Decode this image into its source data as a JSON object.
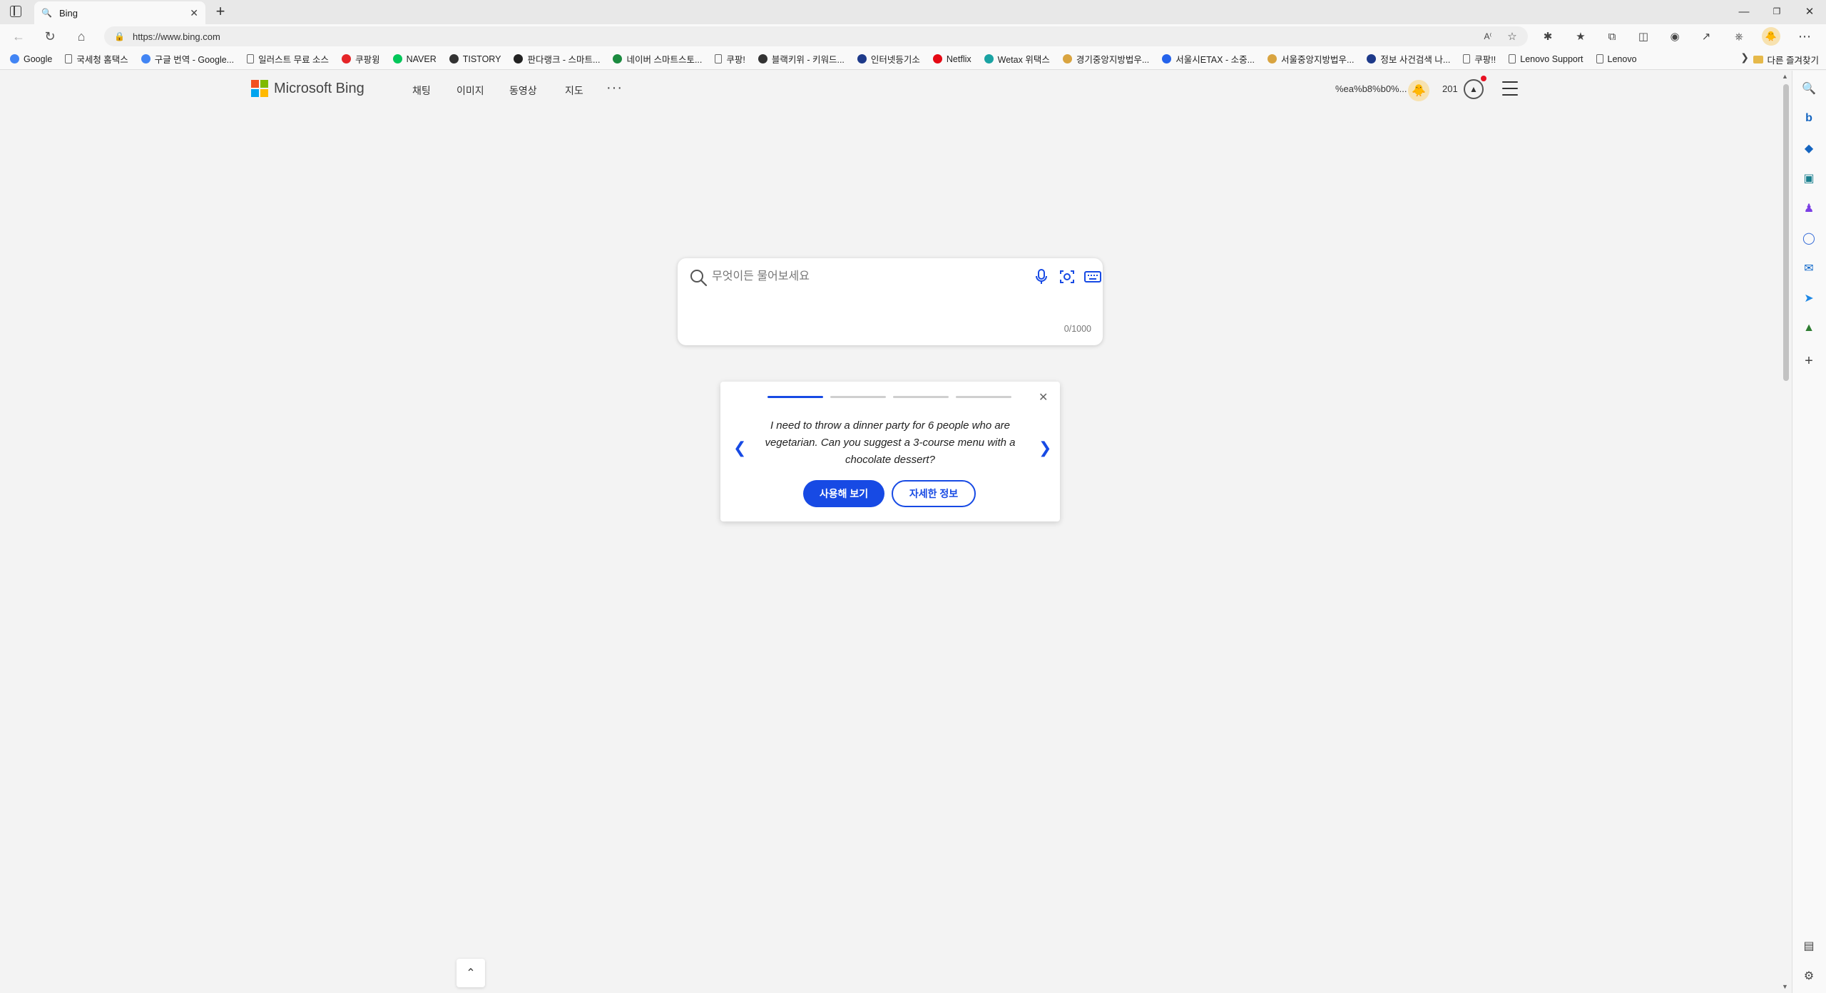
{
  "browser": {
    "tab_title": "Bing",
    "url": "https://www.bing.com",
    "bookmarks": [
      {
        "label": "Google",
        "icon": "google-icon",
        "color": "#4285f4"
      },
      {
        "label": "국세청 홈택스",
        "icon": "page-icon",
        "color": "#666666"
      },
      {
        "label": "구글 번역 - Google...",
        "icon": "google-icon",
        "color": "#4285f4"
      },
      {
        "label": "일러스트 무료 소스",
        "icon": "page-icon",
        "color": "#666666"
      },
      {
        "label": "쿠팡윙",
        "icon": "coupang-icon",
        "color": "#e52528"
      },
      {
        "label": "NAVER",
        "icon": "naver-icon",
        "color": "#03c75a"
      },
      {
        "label": "TISTORY",
        "icon": "tistory-icon",
        "color": "#333333"
      },
      {
        "label": "판다랭크 - 스마트...",
        "icon": "pandarank-icon",
        "color": "#222222"
      },
      {
        "label": "네이버 스마트스토...",
        "icon": "smartstore-icon",
        "color": "#1b8a3f"
      },
      {
        "label": "쿠팡!",
        "icon": "page-icon",
        "color": "#666666"
      },
      {
        "label": "블랙키위 - 키워드...",
        "icon": "blackkiwi-icon",
        "color": "#333333"
      },
      {
        "label": "인터넷등기소",
        "icon": "court-icon",
        "color": "#1e3a8a"
      },
      {
        "label": "Netflix",
        "icon": "netflix-icon",
        "color": "#e50914"
      },
      {
        "label": "Wetax 위택스",
        "icon": "wetax-icon",
        "color": "#1aa3a3"
      },
      {
        "label": "경기중앙지방법우...",
        "icon": "court-seal-icon",
        "color": "#d9a440"
      },
      {
        "label": "서울시ETAX - 소중...",
        "icon": "etax-icon",
        "color": "#2563eb"
      },
      {
        "label": "서울중앙지방법우...",
        "icon": "court-seal-icon",
        "color": "#d9a440"
      },
      {
        "label": "정보 사건검색 나...",
        "icon": "court-icon",
        "color": "#1e3a8a"
      },
      {
        "label": "쿠팡!!",
        "icon": "page-icon",
        "color": "#666666"
      },
      {
        "label": "Lenovo Support",
        "icon": "page-icon",
        "color": "#666666"
      },
      {
        "label": "Lenovo",
        "icon": "page-icon",
        "color": "#666666"
      }
    ],
    "other_favorites": "다른 즐겨찾기"
  },
  "bing": {
    "logo_text": "Microsoft Bing",
    "nav": [
      "채팅",
      "이미지",
      "동영상",
      "지도"
    ],
    "more": "···",
    "username": "%ea%b8%b0%...",
    "points": "201",
    "search": {
      "placeholder": "무엇이든 물어보세요",
      "char_count": "0/1000"
    },
    "suggestion": {
      "text": "I need to throw a dinner party for 6 people who are vegetarian. Can you suggest a 3-course menu with a chocolate dessert?",
      "try_label": "사용해 보기",
      "info_label": "자세한 정보",
      "progress_steps": 4,
      "active_step": 1
    }
  },
  "colors": {
    "accent": "#174ae4",
    "page_bg": "#f3f3f3",
    "ms_red": "#f25022",
    "ms_green": "#7fba00",
    "ms_blue": "#00a4ef",
    "ms_yellow": "#ffb900"
  }
}
